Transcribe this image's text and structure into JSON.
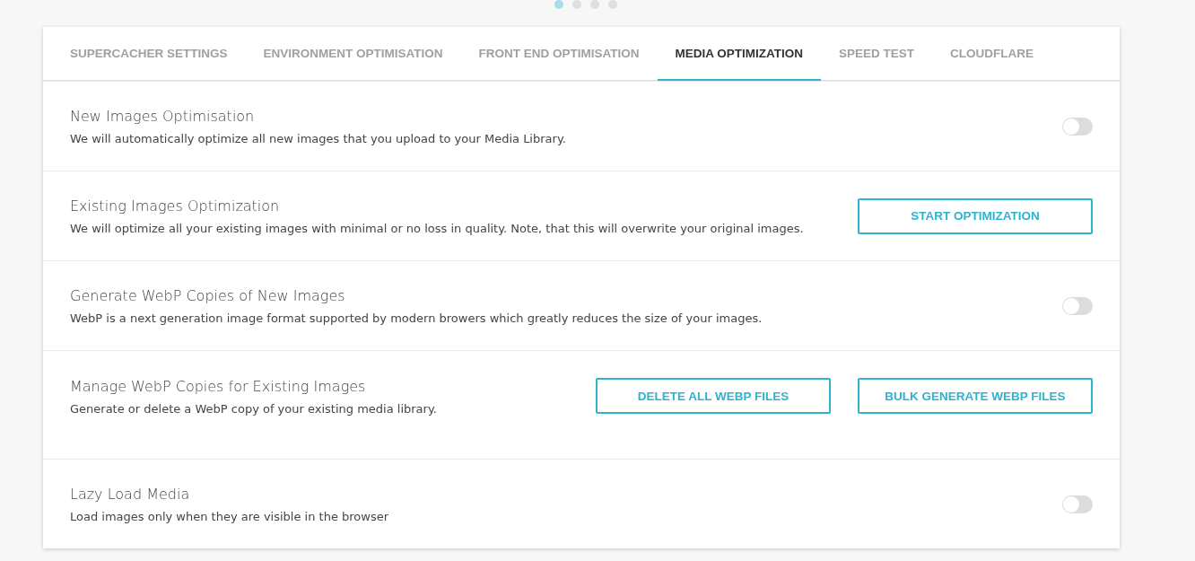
{
  "pager": [
    {
      "selected": true
    },
    {
      "selected": false
    },
    {
      "selected": false
    },
    {
      "selected": false
    }
  ],
  "tabs": [
    {
      "label": "SUPERCACHER SETTINGS",
      "selected": false
    },
    {
      "label": "ENVIRONMENT OPTIMISATION",
      "selected": false
    },
    {
      "label": "FRONT END OPTIMISATION",
      "selected": false
    },
    {
      "label": "MEDIA OPTIMIZATION",
      "selected": true
    },
    {
      "label": "SPEED TEST",
      "selected": false
    },
    {
      "label": "CLOUDFLARE",
      "selected": false
    }
  ],
  "settings": [
    {
      "kind": "toggle",
      "title": "New Images Optimisation",
      "description": "We will automatically optimize all new images that you upload to your Media Library.",
      "on": false
    },
    {
      "kind": "buttons",
      "title": "Existing Images Optimization",
      "description": "We will optimize all your existing images with minimal or no loss in quality. Note, that this will overwrite your original images.",
      "buttons": [
        "START OPTIMIZATION"
      ]
    },
    {
      "kind": "toggle",
      "title": "Generate WebP Copies of New Images",
      "description": "WebP is a next generation image format supported by modern browers which greatly reduces the size of your images.",
      "on": false
    },
    {
      "kind": "buttons",
      "title": "Manage WebP Copies for Existing Images",
      "description": "Generate or delete a WebP copy of your existing media library.",
      "buttons": [
        "DELETE ALL WEBP FILES",
        "BULK GENERATE WEBP FILES"
      ]
    },
    {
      "kind": "toggle",
      "title": "Lazy Load Media",
      "description": "Load images only when they are visible in the browser",
      "on": false
    }
  ]
}
